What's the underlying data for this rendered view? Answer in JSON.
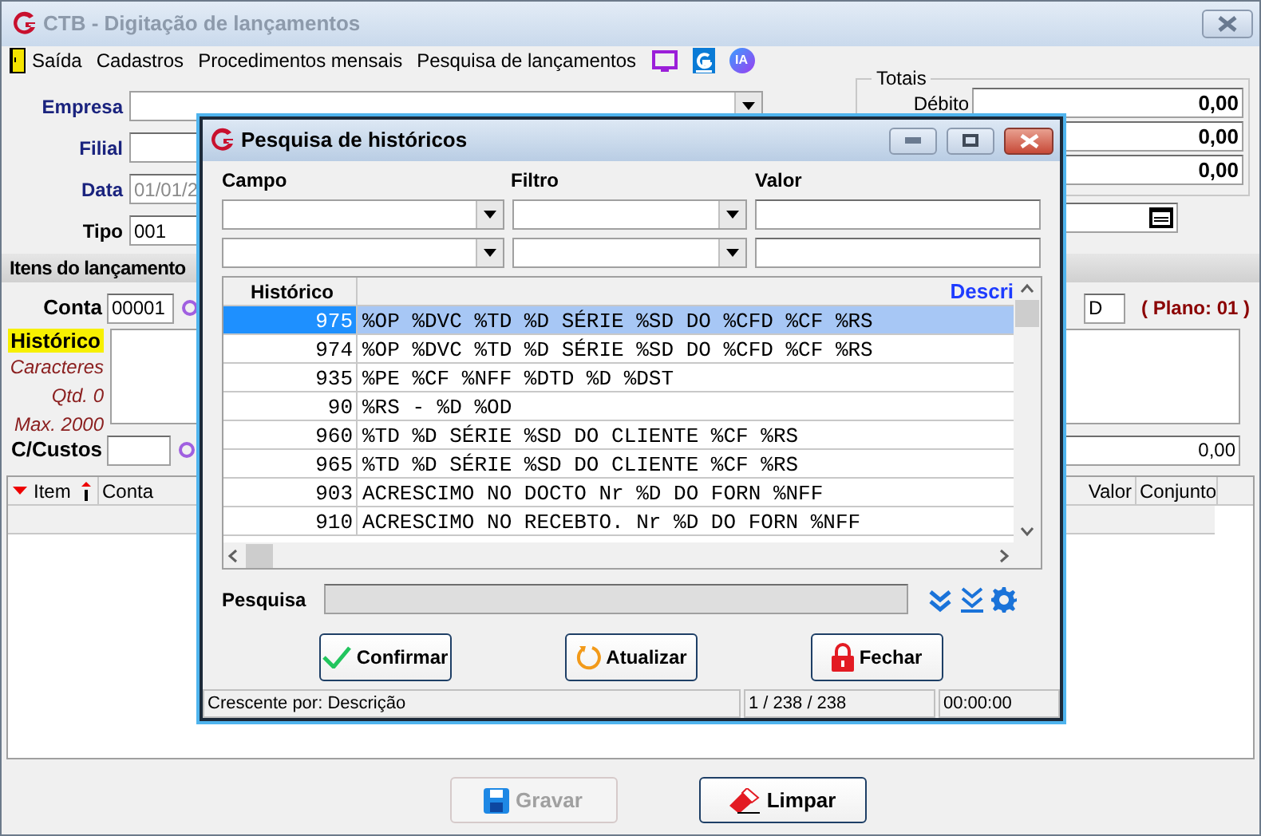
{
  "window": {
    "title": "CTB - Digitação de lançamentos"
  },
  "menu": [
    {
      "label": "Saída",
      "kind": "exit"
    },
    {
      "label": "Cadastros",
      "kind": "text"
    },
    {
      "label": "Procedimentos mensais",
      "kind": "text"
    },
    {
      "label": "Pesquisa de lançamentos",
      "kind": "text"
    },
    {
      "kind": "monitor"
    },
    {
      "kind": "g"
    },
    {
      "label": "IA",
      "kind": "ia"
    }
  ],
  "header_form": {
    "empresa": {
      "label": "Empresa"
    },
    "filial": {
      "label": "Filial"
    },
    "data": {
      "label": "Data",
      "value": "01/01/2",
      "disabled": true
    },
    "tipo": {
      "label": "Tipo",
      "value": "001"
    }
  },
  "totais": {
    "title": "Totais",
    "rows": [
      {
        "label": "Débito",
        "value": "0,00"
      },
      {
        "value": "0,00"
      },
      {
        "value": "0,00"
      }
    ]
  },
  "itens": {
    "title": "Itens do lançamento",
    "conta": {
      "label": "Conta",
      "value": "00001"
    },
    "dc_value": "D",
    "plano": "( Plano: 01 )",
    "historico": {
      "label": "Histórico",
      "caracteres": "Caracteres",
      "qtd": "Qtd. 0",
      "max": "Max. 2000"
    },
    "ccustos": {
      "label": "C/Custos"
    },
    "valor": "0,00",
    "columns": [
      "Item",
      "Conta",
      "Valor",
      "Conjunto"
    ]
  },
  "buttons": [
    {
      "label": "Gravar",
      "disabled": true,
      "kind": "save"
    },
    {
      "label": "Limpar",
      "disabled": false,
      "kind": "clear"
    }
  ],
  "dialog": {
    "title": "Pesquisa de históricos",
    "filter_labels": [
      "Campo",
      "Filtro",
      "Valor"
    ],
    "columns": [
      "Histórico",
      "Descri"
    ],
    "rows": [
      {
        "code": "975",
        "text": "%OP %DVC %TD %D SÉRIE %SD DO %CFD %CF %RS",
        "selected": true
      },
      {
        "code": "974",
        "text": "%OP %DVC %TD %D SÉRIE %SD DO %CFD %CF %RS",
        "selected": false
      },
      {
        "code": "935",
        "text": "%PE %CF %NFF %DTD %D %DST",
        "selected": false
      },
      {
        "code": "90",
        "text": "%RS - %D %OD",
        "selected": false
      },
      {
        "code": "960",
        "text": "%TD %D SÉRIE %SD DO CLIENTE %CF %RS",
        "selected": false
      },
      {
        "code": "965",
        "text": "%TD %D SÉRIE %SD DO CLIENTE %CF %RS",
        "selected": false
      },
      {
        "code": "903",
        "text": "ACRESCIMO NO DOCTO Nr %D DO FORN %NFF",
        "selected": false
      },
      {
        "code": "910",
        "text": "ACRESCIMO NO RECEBTO. Nr %D DO FORN %NFF",
        "selected": false
      }
    ],
    "search_label": "Pesquisa",
    "buttons": [
      {
        "label": "Confirmar",
        "kind": "confirm"
      },
      {
        "label": "Atualizar",
        "kind": "refresh"
      },
      {
        "label": "Fechar",
        "kind": "close"
      }
    ],
    "status": [
      "Crescente por: Descrição",
      "1 / 238 / 238",
      "00:00:00"
    ]
  }
}
